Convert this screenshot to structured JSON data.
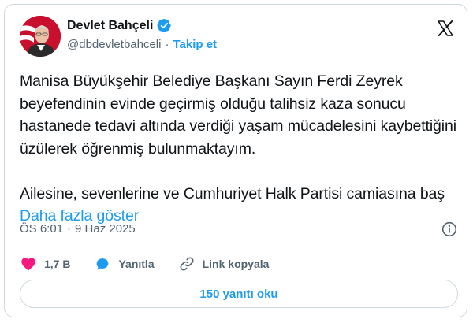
{
  "author": {
    "name": "Devlet Bahçeli",
    "handle": "@dbdevletbahceli",
    "separator": "·",
    "follow_label": "Takip et",
    "verified_color": "#1d9bf0"
  },
  "tweet": {
    "paragraph1": "Manisa Büyükşehir Belediye Başkanı Sayın Ferdi Zeyrek beyefendinin evinde geçirmiş olduğu talihsiz kaza sonucu hastanede tedavi altında verdiği yaşam mücadelesini kaybettiğini üzülerek öğrenmiş bulunmaktayım.",
    "paragraph2": "Ailesine, sevenlerine ve Cumhuriyet Halk Partisi camiasına baş",
    "show_more": "Daha fazla göster"
  },
  "meta": {
    "time": "ÖS 6:01",
    "separator": "·",
    "date": "9 Haz 2025"
  },
  "actions": {
    "likes": "1,7 B",
    "reply_label": "Yanıtla",
    "copy_link_label": "Link kopyala"
  },
  "replies_button": "150 yanıtı oku",
  "colors": {
    "accent": "#1d9bf0",
    "like": "#f91880",
    "secondary_text": "#536471",
    "border": "#cfd9de"
  },
  "icons": {
    "platform_logo": "x-logo-icon",
    "verified": "verified-badge-icon",
    "like": "heart-icon",
    "reply": "reply-bubble-icon",
    "copy_link": "link-icon",
    "info": "info-icon"
  }
}
